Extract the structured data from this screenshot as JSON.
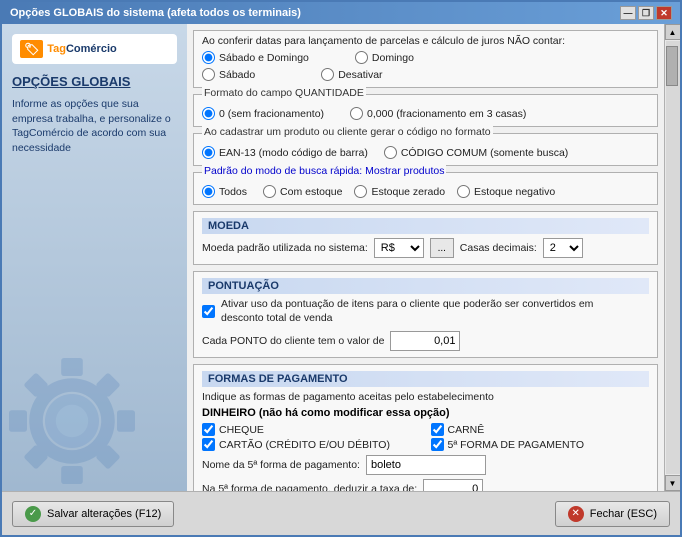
{
  "window": {
    "title": "Opções GLOBAIS do sistema (afeta todos os terminais)",
    "buttons": {
      "minimize": "—",
      "restore": "❐",
      "close": "✕"
    }
  },
  "left_panel": {
    "logo": {
      "tag": "Tag",
      "commerce": "Comércio"
    },
    "title": "OPÇÕES GLOBAIS",
    "description": "Informe as opções que sua empresa trabalha, e personalize o TagComércio de acordo com sua necessidade"
  },
  "date_section": {
    "label": "Ao conferir datas para lançamento de parcelas e cálculo de juros NÃO contar:",
    "options": [
      {
        "id": "sabado_domingo",
        "label": "Sábado e Domingo",
        "checked": true,
        "col": 1
      },
      {
        "id": "domingo",
        "label": "Domingo",
        "checked": false,
        "col": 2
      },
      {
        "id": "sabado",
        "label": "Sábado",
        "checked": false,
        "col": 1
      },
      {
        "id": "desativar",
        "label": "Desativar",
        "checked": false,
        "col": 2
      }
    ]
  },
  "quantidade_section": {
    "label": "Formato do campo QUANTIDADE",
    "options": [
      {
        "id": "zero_int",
        "label": "0 (sem fracionamento)",
        "checked": true
      },
      {
        "id": "zero_dec",
        "label": "0,000 (fracionamento em 3 casas)",
        "checked": false
      }
    ]
  },
  "cadastro_section": {
    "label": "Ao cadastrar um produto ou cliente gerar o código no formato",
    "options": [
      {
        "id": "ean13",
        "label": "EAN-13 (modo código de barra)",
        "checked": true
      },
      {
        "id": "codigo_comum",
        "label": "CÓDIGO COMUM (somente busca)",
        "checked": false
      }
    ]
  },
  "busca_section": {
    "label": "Padrão do modo de busca rápida: Mostrar produtos",
    "options": [
      {
        "id": "todos",
        "label": "Todos",
        "checked": true
      },
      {
        "id": "com_estoque",
        "label": "Com estoque",
        "checked": false
      },
      {
        "id": "estoque_zerado",
        "label": "Estoque zerado",
        "checked": false
      },
      {
        "id": "estoque_negativo",
        "label": "Estoque negativo",
        "checked": false
      }
    ]
  },
  "moeda_section": {
    "title": "MOEDA",
    "label": "Moeda padrão utilizada no sistema:",
    "currency": "R$",
    "btn_dots": "...",
    "casas_label": "Casas decimais:",
    "casas_value": "2"
  },
  "pontuacao_section": {
    "title": "PONTUAÇÃO",
    "checkbox_label": "Ativar uso da pontuação de itens para o cliente que poderão ser convertidos em desconto total de venda",
    "ponto_label": "Cada PONTO do cliente tem o valor de",
    "ponto_value": "0,01",
    "checked": true
  },
  "formas_section": {
    "title": "FORMAS DE PAGAMENTO",
    "subtitle": "Indique as formas de pagamento aceitas pelo estabelecimento",
    "dinheiro_label": "DINHEIRO (não há como modificar essa opção)",
    "items": [
      {
        "id": "cheque",
        "label": "CHEQUE",
        "checked": true,
        "col": 1
      },
      {
        "id": "carne",
        "label": "CARNÊ",
        "checked": true,
        "col": 2
      },
      {
        "id": "cartao",
        "label": "CARTÃO (CRÉDITO E/OU DÉBITO)",
        "checked": true,
        "col": 1
      },
      {
        "id": "quinta",
        "label": "5ª FORMA DE PAGAMENTO",
        "checked": true,
        "col": 2
      }
    ],
    "nome_label": "Nome da 5ª forma de pagamento:",
    "nome_value": "boleto",
    "taxa_label": "Na 5ª forma de pagamento, deduzir a taxa de:",
    "taxa_value": "0"
  },
  "footer": {
    "save_label": "Salvar alterações (F12)",
    "close_label": "Fechar (ESC)"
  }
}
